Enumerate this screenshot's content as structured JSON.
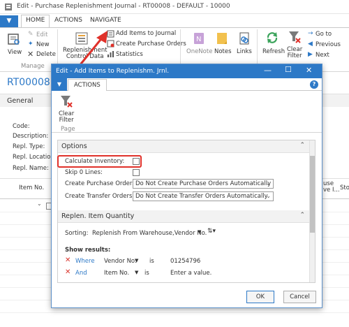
{
  "window": {
    "title": "Edit - Purchase Replenishment Journal - RT00008 - DEFAULT - 10000"
  },
  "ribbon": {
    "file_label": "▼",
    "tabs": [
      "HOME",
      "ACTIONS",
      "NAVIGATE"
    ],
    "view": "View",
    "edit": "Edit",
    "new": "New",
    "delete": "Delete",
    "manage_group": "Manage",
    "replenishment_control_data": "Replenishment\nControl Data",
    "add_items_to_journal": "Add Items to Journal",
    "create_purchase_orders": "Create Purchase Orders",
    "statistics": "Statistics",
    "onenote": "OneNote",
    "notes": "Notes",
    "links": "Links",
    "refresh": "Refresh",
    "clear_filter": "Clear\nFilter",
    "go_to": "Go to",
    "previous": "Previous",
    "next": "Next"
  },
  "page": {
    "heading": "RT00008 · D",
    "general_section": "General",
    "fields": [
      "Code:",
      "Description:",
      "Repl. Type:",
      "Repl. Location:",
      "Repl. Name:"
    ],
    "grid_headers": [
      "Item No.",
      "use\nve I...",
      "Sto"
    ]
  },
  "dialog": {
    "title": "Edit - Add Items to Replenishm. Jrnl.",
    "file_label": "▼",
    "tab": "ACTIONS",
    "help": "?",
    "clear_filter": "Clear\nFilter",
    "page_group": "Page",
    "options_section": "Options",
    "calculate_inventory_label": "Calculate Inventory:",
    "calculate_inventory_checked": false,
    "skip_zero_lines_label": "Skip 0 Lines:",
    "skip_zero_lines_checked": false,
    "create_purchase_orders_label": "Create Purchase Orders:",
    "create_purchase_orders_value": "Do Not Create Purchase Orders Automatically",
    "create_transfer_orders_label": "Create Transfer Orders:",
    "create_transfer_orders_value": "Do Not Create Transfer Orders Automatically",
    "replen_section": "Replen. Item Quantity",
    "sorting_label": "Sorting:",
    "sorting_value": "Replenish From Warehouse,Vendor No.",
    "show_results_label": "Show results:",
    "filters": [
      {
        "conj": "Where",
        "field": "Vendor No.",
        "op": "is",
        "value": "01254796"
      },
      {
        "conj": "And",
        "field": "Item No.",
        "op": "is",
        "value": "Enter a value."
      }
    ],
    "ok": "OK",
    "cancel": "Cancel"
  }
}
